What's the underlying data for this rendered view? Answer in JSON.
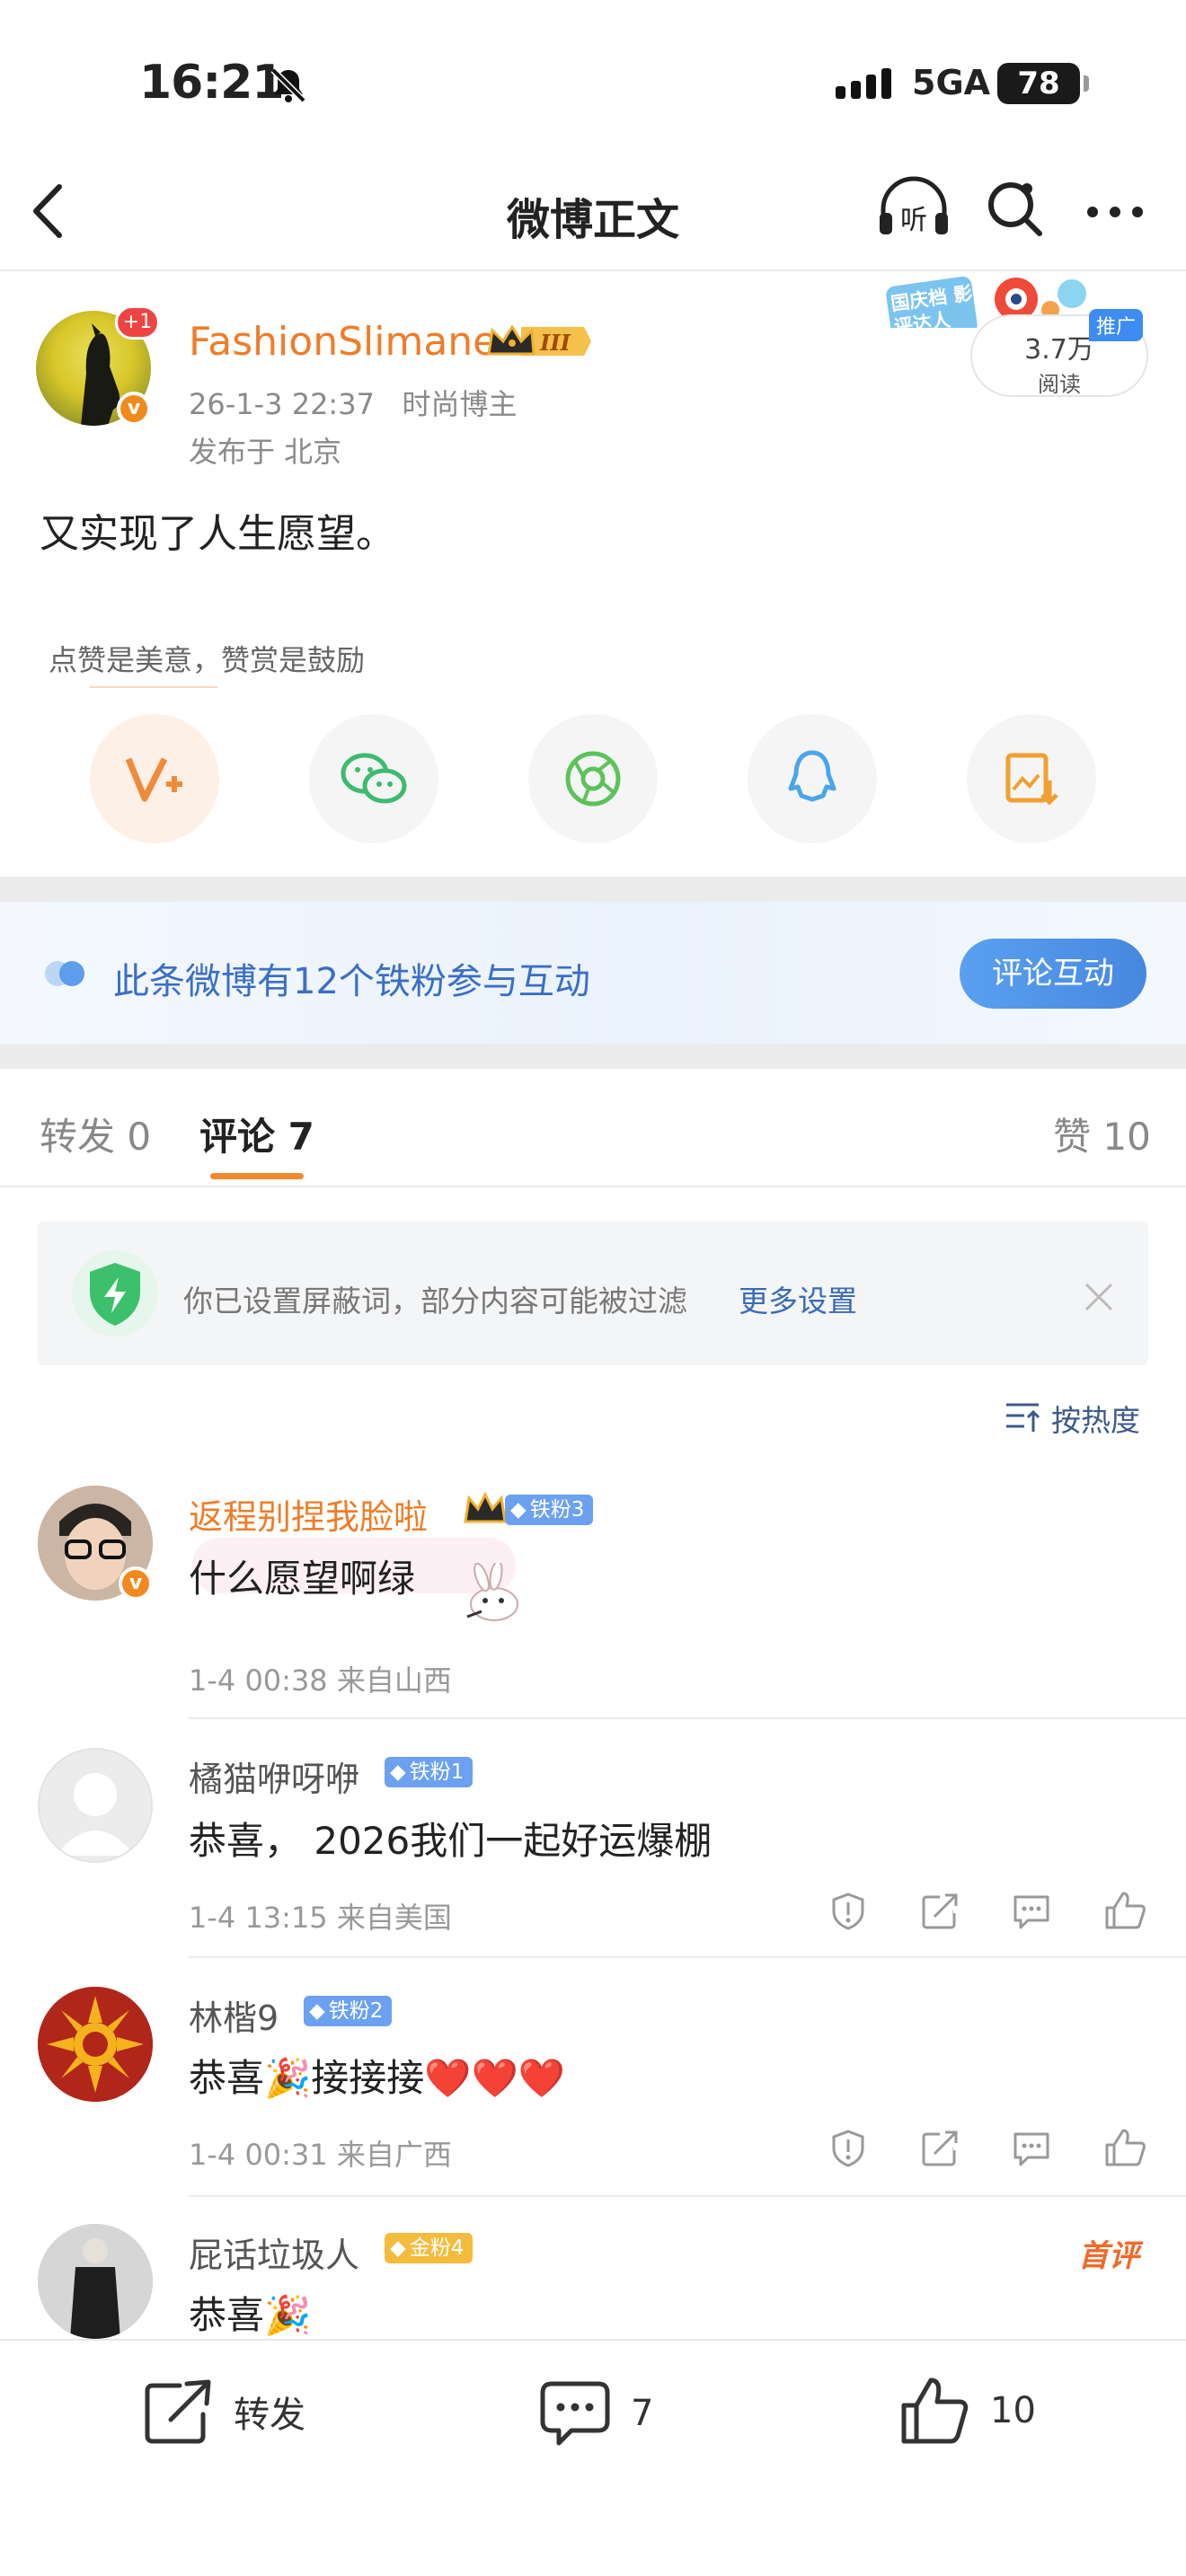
{
  "status_bar": {
    "time": "16:21",
    "network": "5GA",
    "battery": "78"
  },
  "nav": {
    "title": "微博正文",
    "listen_label": "听"
  },
  "post": {
    "author": "FashionSlimane",
    "author_level": "III",
    "avatar_plus": "+1",
    "timestamp": "26-1-3 22:37",
    "category": "时尚博主",
    "location_line": "发布于 北京",
    "promo_text": "国庆档 影评达人",
    "reads": "3.7万",
    "reads_label": "阅读",
    "promo_badge": "推广",
    "text": "又实现了人生愿望。",
    "reward_tip": "点赞是美意，赞赏是鼓励"
  },
  "fans_banner": {
    "text": "此条微博有12个铁粉参与互动",
    "button": "评论互动"
  },
  "tabs": [
    {
      "label": "转发",
      "count": "0"
    },
    {
      "label": "评论",
      "count": "7"
    },
    {
      "label": "赞",
      "count": "10"
    }
  ],
  "shield": {
    "text": "你已设置屏蔽词，部分内容可能被过滤",
    "link": "更多设置"
  },
  "sort_label": "按热度",
  "comments": [
    {
      "name": "返程别捏我脸啦",
      "badge": "铁粉3",
      "text": "什么愿望啊绿",
      "meta": "1-4 00:38  来自山西"
    },
    {
      "name": "橘猫咿呀咿",
      "badge": "铁粉1",
      "text": "恭喜， 2026我们一起好运爆棚",
      "meta": "1-4 13:15  来自美国"
    },
    {
      "name": "林楷9",
      "badge": "铁粉2",
      "text": "恭喜🎉接接接❤️❤️❤️",
      "meta": "1-4 00:31  来自广西"
    },
    {
      "name": "屁话垃圾人",
      "badge": "金粉4",
      "text": "恭喜🎉",
      "tag": "首评"
    }
  ],
  "bottom_bar": {
    "repost": "转发",
    "comments": "7",
    "likes": "10"
  },
  "colors": {
    "accent": "#ee7d28",
    "link": "#3b6bb5",
    "fan_blue": "#6ba1f0"
  }
}
